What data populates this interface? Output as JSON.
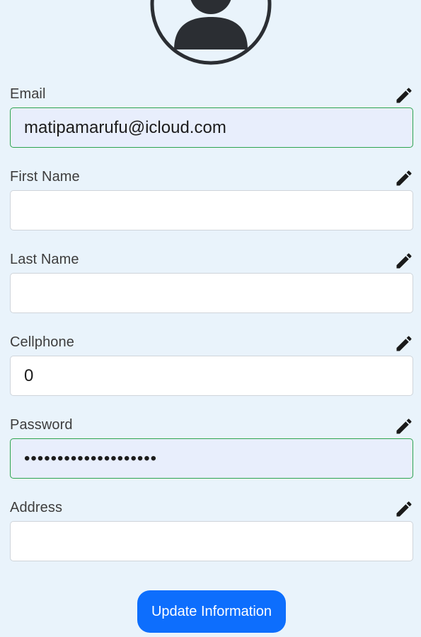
{
  "profile": {
    "avatar_icon": "user-circle-icon"
  },
  "form": {
    "fields": [
      {
        "label": "Email",
        "type": "email",
        "value": "matipamarufu@icloud.com",
        "edit_icon": "pencil-icon"
      },
      {
        "label": "First Name",
        "type": "text",
        "value": "",
        "edit_icon": "pencil-icon"
      },
      {
        "label": "Last Name",
        "type": "text",
        "value": "",
        "edit_icon": "pencil-icon"
      },
      {
        "label": "Cellphone",
        "type": "tel",
        "value": "0",
        "edit_icon": "pencil-icon"
      },
      {
        "label": "Password",
        "type": "password",
        "value": "••••••••••••••••••••",
        "edit_icon": "pencil-icon"
      },
      {
        "label": "Address",
        "type": "text",
        "value": "",
        "edit_icon": "pencil-icon"
      }
    ],
    "submit_label": "Update Information"
  },
  "colors": {
    "page_background": "#e9f3fb",
    "button_primary": "#0d6efd",
    "autofill_background": "#e8eefc",
    "autofill_border": "#2ea44f"
  }
}
